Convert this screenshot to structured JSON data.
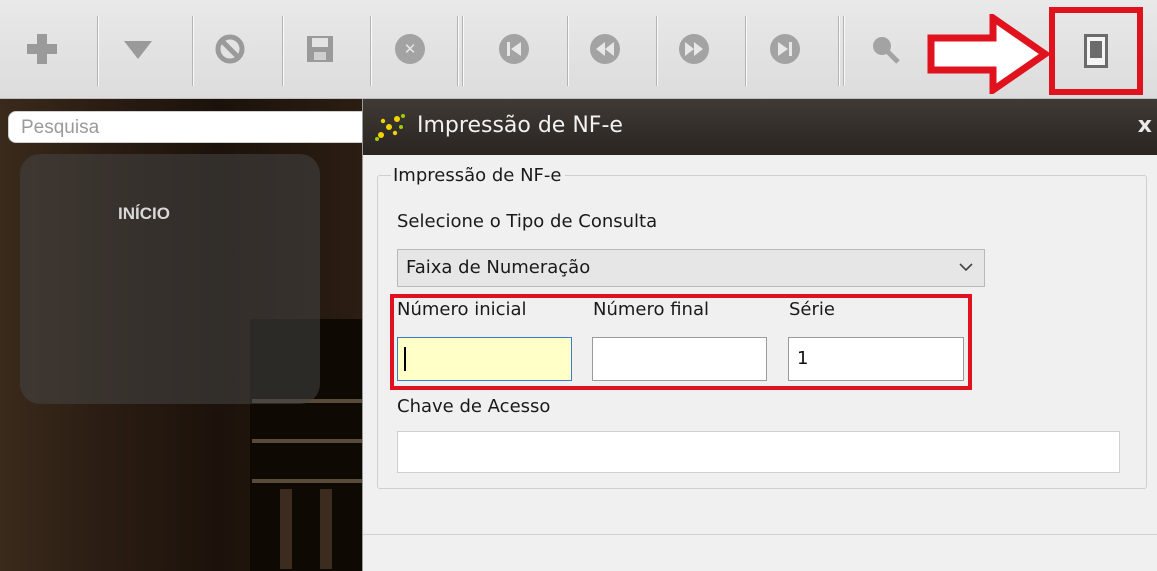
{
  "toolbar": {
    "buttons": [
      {
        "icon": "plus-icon",
        "glyph": "+"
      },
      {
        "icon": "dropdown-arrow-icon",
        "glyph": "▼"
      },
      {
        "icon": "cancel-icon",
        "glyph": "⊘"
      },
      {
        "icon": "save-icon",
        "glyph": ""
      },
      {
        "icon": "delete-icon",
        "glyph": "✕"
      },
      {
        "icon": "first-record-icon",
        "glyph": "⏮"
      },
      {
        "icon": "previous-record-icon",
        "glyph": "⏪"
      },
      {
        "icon": "next-record-icon",
        "glyph": "⏩"
      },
      {
        "icon": "last-record-icon",
        "glyph": "⏭"
      },
      {
        "icon": "search-icon",
        "glyph": ""
      }
    ],
    "print_icon": "print-report-icon",
    "annotation_color": "#e0121d"
  },
  "left": {
    "search_placeholder": "Pesquisa",
    "menu_label": "INÍCIO"
  },
  "dialog": {
    "title": "Impressão de NF-e",
    "close": "x",
    "group_title": "Impressão de NF-e",
    "query_type_label": "Selecione o Tipo de Consulta",
    "query_type_value": "Faixa de Numeração",
    "start_number_label": "Número inicial",
    "start_number_value": "",
    "end_number_label": "Número final",
    "end_number_value": "",
    "series_label": "Série",
    "series_value": "1",
    "access_key_label": "Chave de Acesso",
    "access_key_value": ""
  }
}
